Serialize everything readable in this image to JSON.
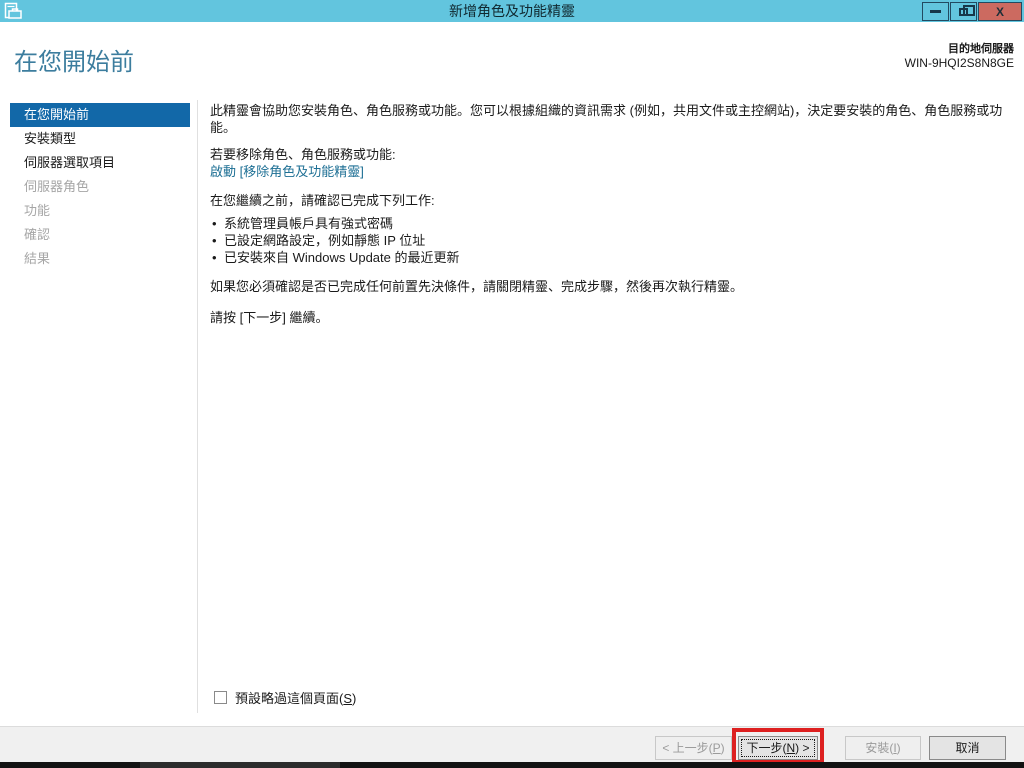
{
  "window": {
    "title": "新增角色及功能精靈",
    "close_glyph": "X"
  },
  "header": {
    "page_title": "在您開始前",
    "destination_label": "目的地伺服器",
    "server_name": "WIN-9HQI2S8N8GE"
  },
  "sidebar": {
    "items": [
      {
        "label": "在您開始前",
        "state": "selected"
      },
      {
        "label": "安裝類型",
        "state": "enabled"
      },
      {
        "label": "伺服器選取項目",
        "state": "enabled"
      },
      {
        "label": "伺服器角色",
        "state": "disabled"
      },
      {
        "label": "功能",
        "state": "disabled"
      },
      {
        "label": "確認",
        "state": "disabled"
      },
      {
        "label": "結果",
        "state": "disabled"
      }
    ]
  },
  "content": {
    "intro": "此精靈會協助您安裝角色、角色服務或功能。您可以根據組織的資訊需求 (例如，共用文件或主控網站)，決定要安裝的角色、角色服務或功能。",
    "remove_heading": "若要移除角色、角色服務或功能:",
    "remove_link": "啟動 [移除角色及功能精靈]",
    "confirm_heading": "在您繼續之前，請確認已完成下列工作:",
    "bullets": [
      "系統管理員帳戶具有強式密碼",
      "已設定網路設定，例如靜態 IP 位址",
      "已安裝來自 Windows Update 的最近更新"
    ],
    "note": "如果您必須確認是否已完成任何前置先決條件，請關閉精靈、完成步驟，然後再次執行精靈。",
    "next_hint": "請按 [下一步] 繼續。",
    "skip_checkbox": {
      "pre": "預設略過這個頁面(",
      "key": "S",
      "post": ")"
    }
  },
  "footer": {
    "prev": {
      "pre": "< 上一步(",
      "key": "P",
      "post": ")"
    },
    "next": {
      "pre": "下一步(",
      "key": "N",
      "post": ") >"
    },
    "install": {
      "pre": "安裝(",
      "key": "I",
      "post": ")"
    },
    "cancel_label": "取消"
  },
  "colors": {
    "titlebar": "#62c5de",
    "close_button": "#cc6a60",
    "nav_selected": "#1268a8",
    "heading": "#3c7d9e",
    "link": "#1d6f94",
    "annotation": "#dd2020"
  }
}
